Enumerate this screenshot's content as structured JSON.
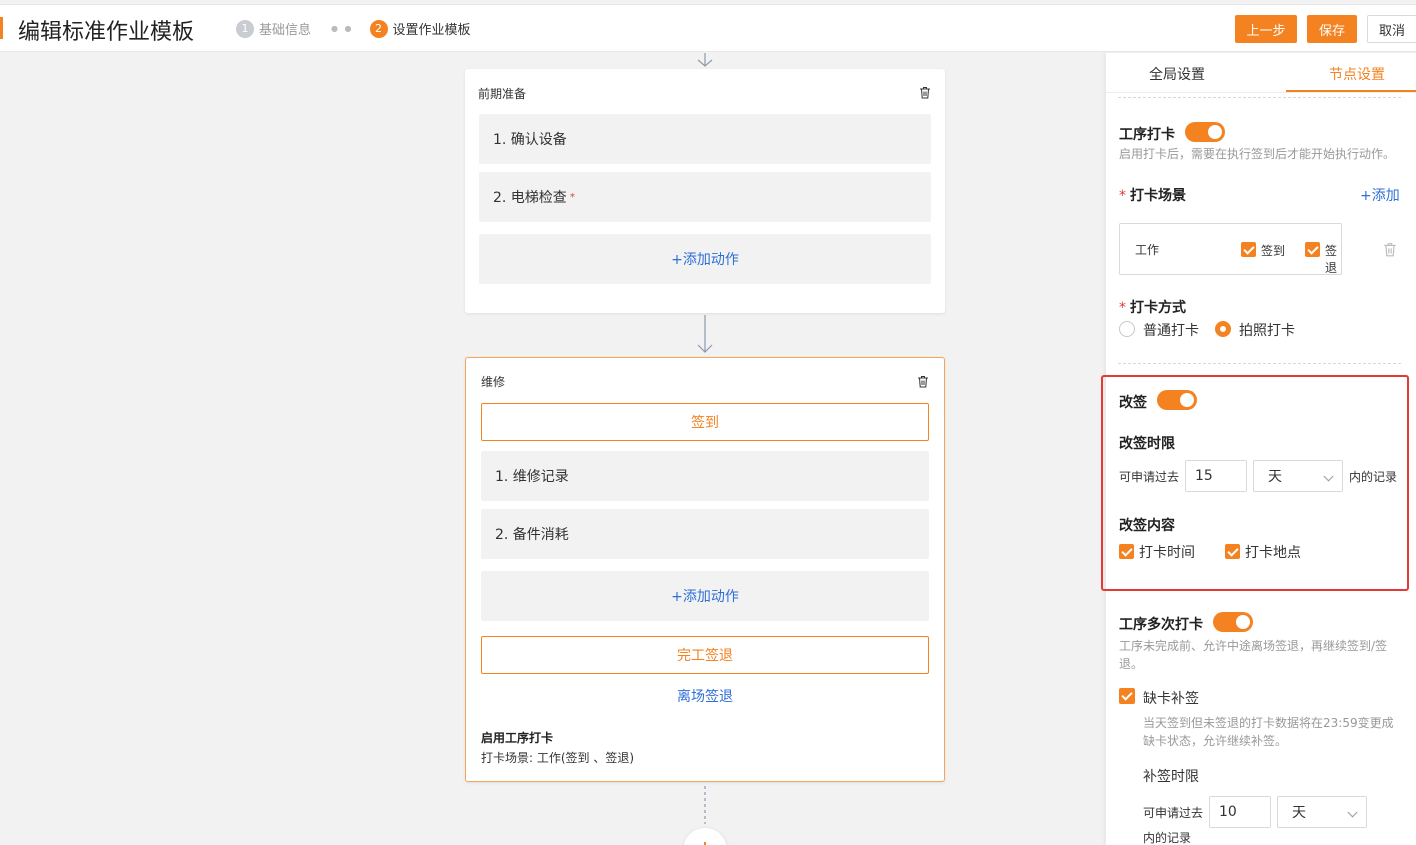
{
  "header": {
    "title": "编辑标准作业模板",
    "steps": [
      {
        "num": "1",
        "label": "基础信息"
      },
      {
        "num": "2",
        "label": "设置作业模板"
      }
    ],
    "prev_label": "上一步",
    "save_label": "保存",
    "cancel_label": "取消"
  },
  "flow": {
    "card1": {
      "title": "前期准备",
      "actions": [
        "1. 确认设备",
        "2. 电梯检查"
      ],
      "required_mark": "*",
      "add_action": "+添加动作"
    },
    "card2": {
      "title": "维修",
      "checkin": "签到",
      "actions": [
        "1. 维修记录",
        "2. 备件消耗"
      ],
      "add_action": "+添加动作",
      "finish_checkout": "完工签退",
      "leave_checkout": "离场签退",
      "summary_title": "启用工序打卡",
      "summary_text": "打卡场景: 工作(签到 、签退)"
    }
  },
  "panel": {
    "tabs": [
      "全局设置",
      "节点设置"
    ],
    "active_tab": "节点设置",
    "process_checkin": {
      "label": "工序打卡",
      "enabled": true,
      "hint": "启用打卡后，需要在执行签到后才能开始执行动作。"
    },
    "scene": {
      "label": "打卡场景",
      "add": "+添加",
      "name": "工作",
      "opt_checkin": "签到",
      "opt_checkout": "签退"
    },
    "method": {
      "label": "打卡方式",
      "options": [
        "普通打卡",
        "拍照打卡"
      ],
      "selected": "拍照打卡"
    },
    "resign": {
      "label": "改签",
      "enabled": true,
      "limit_label": "改签时限",
      "prefix": "可申请过去",
      "value": "15",
      "unit": "天",
      "suffix": "内的记录",
      "content_label": "改签内容",
      "content_options": [
        "打卡时间",
        "打卡地点"
      ]
    },
    "multi": {
      "label": "工序多次打卡",
      "enabled": true,
      "hint": "工序未完成前、允许中途离场签退，再继续签到/签退。"
    },
    "makeup": {
      "label": "缺卡补签",
      "hint": "当天签到但未签退的打卡数据将在23:59变更成缺卡状态，允许继续补签。",
      "limit_label": "补签时限",
      "prefix": "可申请过去",
      "value": "10",
      "unit": "天",
      "suffix": "内的记录"
    }
  },
  "colors": {
    "accent": "#f48220",
    "link": "#2f6fd6",
    "highlight": "#e53935"
  }
}
